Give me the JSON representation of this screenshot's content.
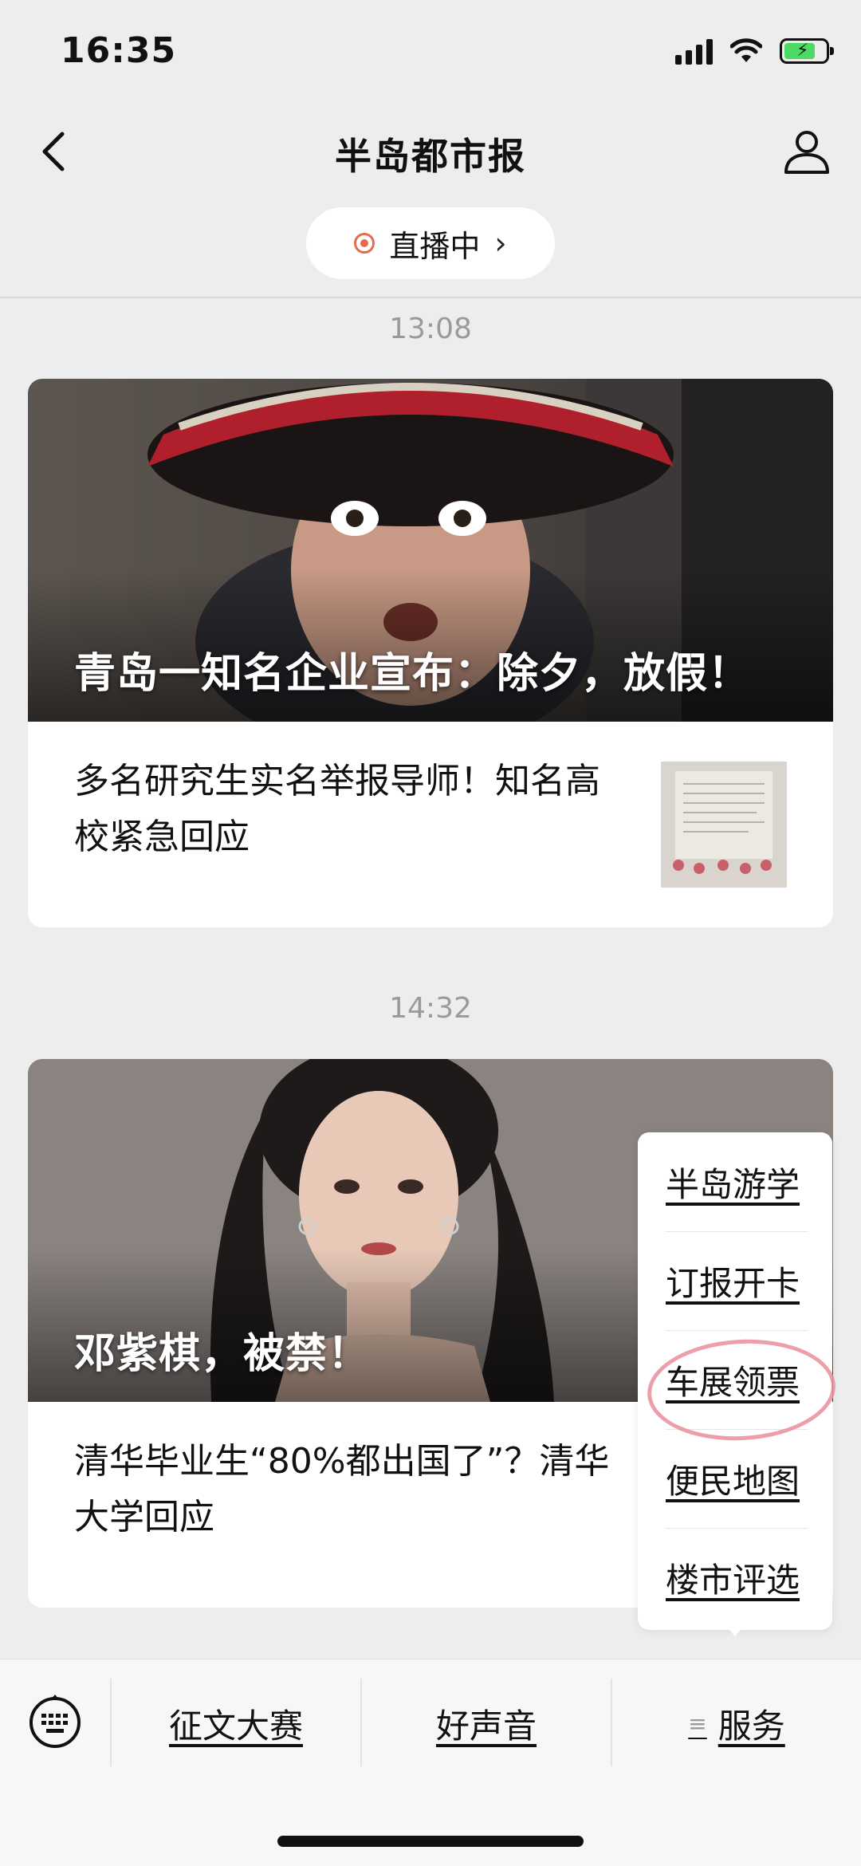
{
  "status_bar": {
    "time": "16:35",
    "battery_level": 0.75,
    "battery_color": "#4cd964"
  },
  "nav": {
    "title": "半岛都市报"
  },
  "live": {
    "label": "直播中"
  },
  "feed": [
    {
      "timestamp": "13:08",
      "hero_title": "青岛一知名企业宣布：除夕，放假！",
      "item_text": "多名研究生实名举报导师！知名高校紧急回应"
    },
    {
      "timestamp": "14:32",
      "hero_title": "邓紫棋，被禁！",
      "item_text": "清华毕业生“80%都出国了”？清华大学回应"
    }
  ],
  "service_menu": {
    "items": [
      "半岛游学",
      "订报开卡",
      "车展领票",
      "便民地图",
      "楼市评选"
    ],
    "highlighted": "车展领票",
    "highlight_color": "#e98e9a"
  },
  "bottom_tabs": [
    "征文大赛",
    "好声音",
    "服务"
  ],
  "colors": {
    "accent_live": "#e56b4f",
    "page_bg": "#ededed",
    "timestamp": "#9a9a9a"
  }
}
